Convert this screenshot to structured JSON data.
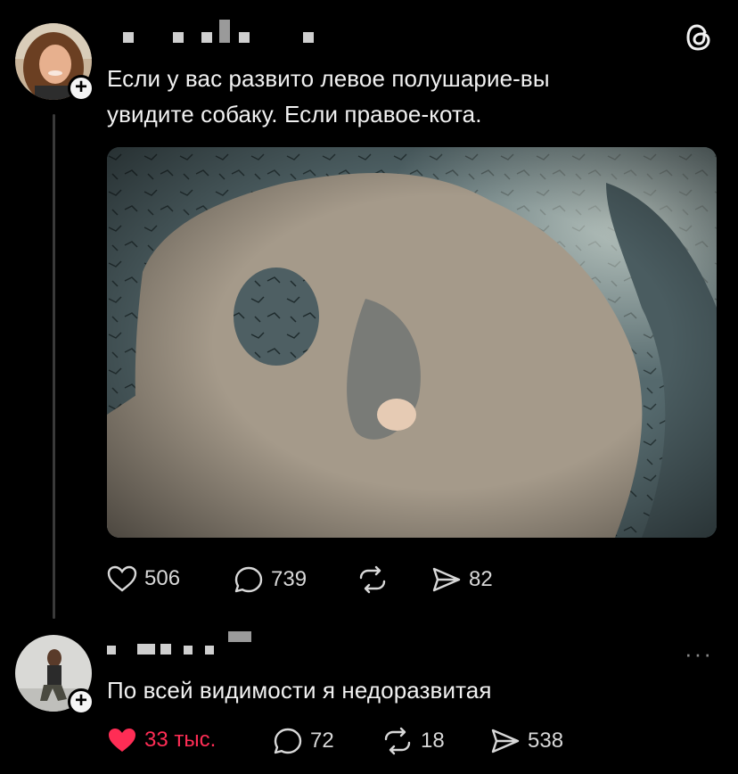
{
  "app": {
    "logo_icon": "threads-logo-icon"
  },
  "post": {
    "text_line1": "Если у вас развито левое полушарие-вы",
    "text_line2": "увидите собаку. Если правое-кота.",
    "avatar_badge": "+",
    "actions": {
      "likes": "506",
      "replies": "739",
      "repost_icon": "repost-icon",
      "shares": "82"
    }
  },
  "reply": {
    "text": "По всей видимости я недоразвитая",
    "avatar_badge": "+",
    "more": "···",
    "actions": {
      "likes": "33 тыс.",
      "replies": "72",
      "reposts": "18",
      "shares": "538"
    }
  },
  "colors": {
    "background": "#000000",
    "like_active": "#ff2d55",
    "text": "#f1f1f1",
    "muted": "#d8d8d8"
  }
}
